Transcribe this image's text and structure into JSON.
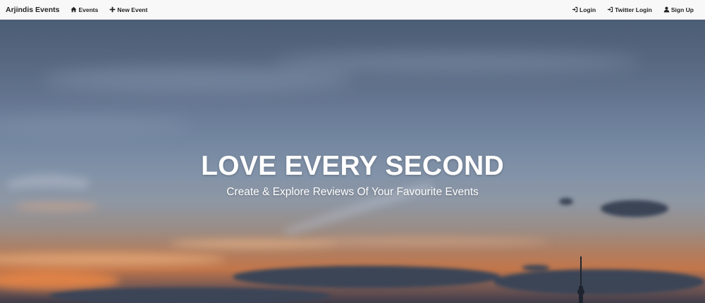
{
  "navbar": {
    "brand": "Arjindis Events",
    "left_items": [
      {
        "label": "Events",
        "icon": "home-icon"
      },
      {
        "label": "New Event",
        "icon": "plus-icon"
      }
    ],
    "right_items": [
      {
        "label": "Login",
        "icon": "log-in-icon"
      },
      {
        "label": "Twitter Login",
        "icon": "log-in-icon"
      },
      {
        "label": "Sign Up",
        "icon": "user-icon"
      }
    ],
    "background": "#f8f8f8"
  },
  "hero": {
    "title": "LOVE EVERY SECOND",
    "subtitle": "Create & Explore Reviews Of Your Favourite Events",
    "text_color": "#ffffff",
    "sky_colors": [
      "#4b5d75",
      "#8192a8",
      "#c2764a"
    ]
  }
}
